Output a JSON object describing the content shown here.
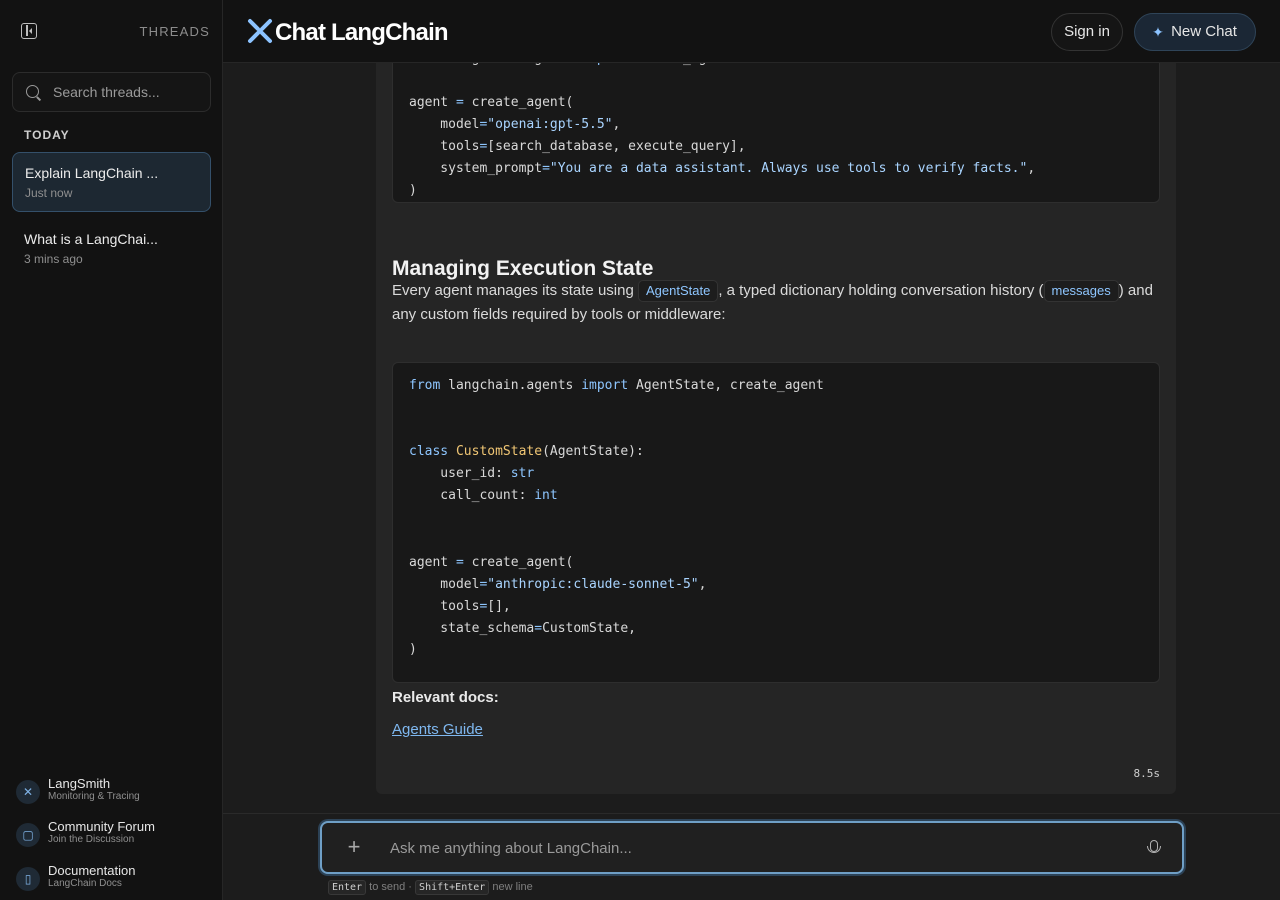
{
  "sidebar": {
    "threads_label": "THREADS",
    "search_placeholder": "Search threads...",
    "section_today": "TODAY",
    "threads": [
      {
        "title": "Explain LangChain ...",
        "time": "Just now"
      },
      {
        "title": "What is a LangChai...",
        "time": "3 mins ago"
      }
    ],
    "links": [
      {
        "title": "LangSmith",
        "subtitle": "Monitoring & Tracing",
        "icon": "langsmith-icon"
      },
      {
        "title": "Community Forum",
        "subtitle": "Join the Discussion",
        "icon": "chat-bubble-icon"
      },
      {
        "title": "Documentation",
        "subtitle": "LangChain Docs",
        "icon": "book-icon"
      }
    ]
  },
  "header": {
    "logo_text": "Chat LangChain",
    "sign_in": "Sign in",
    "new_chat": "New Chat"
  },
  "message": {
    "code_block_1": [
      "from langchain.agents import create_agent",
      "",
      "agent = create_agent(",
      "    model=\"openai:gpt-5.5\",",
      "    tools=[search_database, execute_query],",
      "    system_prompt=\"You are a data assistant. Always use tools to verify facts.\",",
      ")"
    ],
    "heading": "Managing Execution State",
    "para_part1": "Every agent manages its state using",
    "inline_code_1": "AgentState",
    "para_part2": ", a typed dictionary holding conversation history (",
    "inline_code_2": "messages",
    "para_part3": ") and any custom fields required by tools or middleware:",
    "code_block_2": [
      "from langchain.agents import AgentState, create_agent",
      "",
      "",
      "class CustomState(AgentState):",
      "    user_id: str",
      "    call_count: int",
      "",
      "",
      "agent = create_agent(",
      "    model=\"anthropic:claude-sonnet-5\",",
      "    tools=[],",
      "    state_schema=CustomState,",
      ")"
    ],
    "relevant_docs_label": "Relevant docs:",
    "doc_link": "Agents Guide",
    "elapsed": "8.5s"
  },
  "composer": {
    "placeholder": "Ask me anything about LangChain...",
    "hint_key1": "Enter",
    "hint_text1": "to send ·",
    "hint_key2": "Shift+Enter",
    "hint_text2": "new line"
  },
  "colors": {
    "accent": "#8ec6ff",
    "active_thread_bg": "#1d2832",
    "composer_border": "#6f9fc6"
  }
}
